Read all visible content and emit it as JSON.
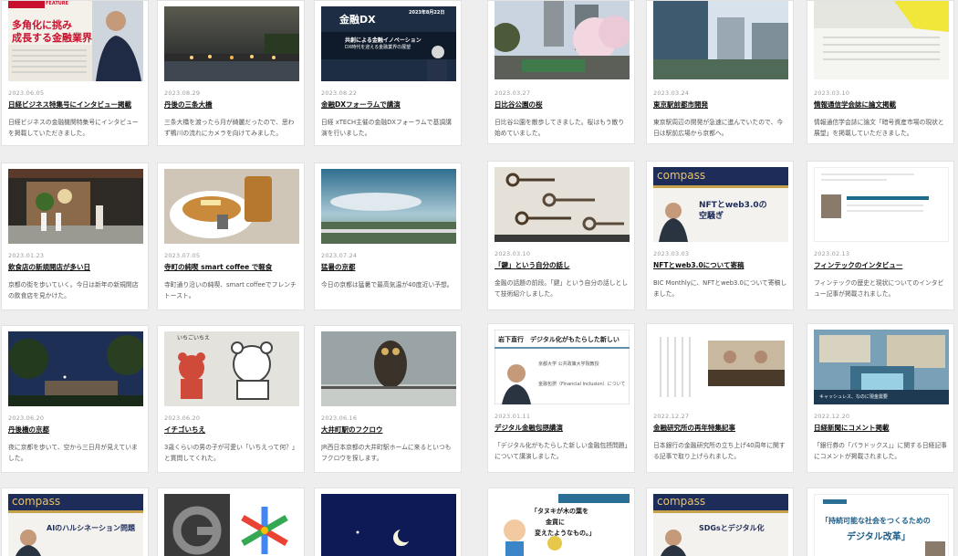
{
  "cards": [
    {
      "date": "2023.06.05",
      "title": "日経ビジネス特集号にインタビュー掲載",
      "excerpt": "日経ビジネスの金融機関特集号にインタビューを掲載していただきました。",
      "thumb_text": [
        "多角化に挑み",
        "成長する金融業界"
      ],
      "thumb_badge": "SPECIAL FEATURE"
    },
    {
      "date": "2023.08.29",
      "title": "丹後の三条大橋",
      "excerpt": "三条大橋を渡ったら月が綺麗だったので、思わず鴨川の流れにカメラを向けてみました。"
    },
    {
      "date": "2023.08.22",
      "title": "金融DXフォーラムで講演",
      "excerpt": "日経 xTECH主催の金融DXフォーラムで基調講演を行いました。",
      "thumb_text": [
        "金融DX",
        "共創による金融イノベーション",
        "DX時代を迎える金融業界の展望"
      ],
      "thumb_badge": "2023年8月22日"
    },
    {
      "date": "2023.03.27",
      "title": "日比谷公園の桜",
      "excerpt": "日比谷公園を散歩してきました。桜はもう散り始めていました。"
    },
    {
      "date": "2023.03.24",
      "title": "東京駅前都市開発",
      "excerpt": "東京駅周辺の開発が急速に進んでいたので、今日は駅前広場から京都へ。"
    },
    {
      "date": "2023.03.10",
      "title": "情報通信学会誌に論文掲載",
      "excerpt": "情報通信学会誌に論文「暗号資産市場の現状と展望」を掲載していただきました。"
    },
    {
      "date": "2023.01.23",
      "title": "飲食店の新規開店が多い日",
      "excerpt": "京都の街を歩いていく。今日は新年の新規開店の飲食店を見かけた。"
    },
    {
      "date": "2023.07.05",
      "title": "寺町の純喫 smart coffee で軽食",
      "excerpt": "寺町通り沿いの純喫、smart coffeeでフレンチトースト。"
    },
    {
      "date": "2023.07.24",
      "title": "猛暑の京都",
      "excerpt": "今日の京都は猛暑で最高気温が40度近い予想。"
    },
    {
      "date": "2023.03.10",
      "title": "「鍵」という自分の話し",
      "excerpt": "金融の話題の前段。「鍵」という自分の話しとして技術紹介しました。"
    },
    {
      "date": "2023.03.03",
      "title": "NFTとweb3.0について寄稿",
      "excerpt": "BIC Monthlyに、NFTとweb3.0について寄稿しました。",
      "thumb_text": [
        "compass",
        "NFTとweb3.0の",
        "空騒ぎ"
      ]
    },
    {
      "date": "2023.02.13",
      "title": "フィンテックのインタビュー",
      "excerpt": "フィンテックの歴史と現状についてのインタビュー記事が掲載されました。"
    },
    {
      "date": "2023.06.20",
      "title": "丹後橋の京都",
      "excerpt": "夜に京都を歩いて、空から三日月が見えていました。"
    },
    {
      "date": "2023.06.20",
      "title": "イチゴいちえ",
      "excerpt": "3歳くらいの男の子が可愛い「いちえって何？」と質問してくれた。",
      "thumb_text": [
        "いちごいちえ"
      ]
    },
    {
      "date": "2023.06.16",
      "title": "大井町駅のフクロウ",
      "excerpt": "JR西日本京都の大井町駅ホームに来るといつもフクロウを探します。"
    },
    {
      "date": "2023.01.11",
      "title": "デジタル金融包摂講演",
      "excerpt": "「デジタル化がもたらした新しい金融包摂問題」について講演しました。",
      "thumb_text": [
        "岩下直行　デジタル化がもたらした新しい",
        "京都大学 公共政策大学院教授",
        "金融包摂（Financial Inclusion）について"
      ]
    },
    {
      "date": "2022.12.27",
      "title": "金融研究所の再年特集記事",
      "excerpt": "日本銀行の金融研究所の立ち上げ40周年に関する記事で取り上げられました。"
    },
    {
      "date": "2022.12.20",
      "title": "日経新聞にコメント掲載",
      "excerpt": "「銀行券の「パラドックス」」に関する日経記事にコメントが掲載されました。",
      "thumb_text": [
        "キャッシュレス、なのに現金需要"
      ]
    },
    {
      "date": "",
      "title": "",
      "excerpt": "",
      "thumb_text": [
        "compass",
        "AIのハルシネーション問題"
      ]
    },
    {
      "date": "",
      "title": "",
      "excerpt": ""
    },
    {
      "date": "",
      "title": "",
      "excerpt": ""
    },
    {
      "date": "",
      "title": "",
      "excerpt": "",
      "thumb_text": [
        "「タヌキが木の葉を",
        "金貨に",
        "変えたようなもの。」"
      ]
    },
    {
      "date": "",
      "title": "",
      "excerpt": "",
      "thumb_text": [
        "compass",
        "SDGsとデジタル化"
      ]
    },
    {
      "date": "",
      "title": "",
      "excerpt": "",
      "thumb_text": [
        "「持続可能な社会をつくるための",
        "デジタル改革」"
      ]
    }
  ]
}
